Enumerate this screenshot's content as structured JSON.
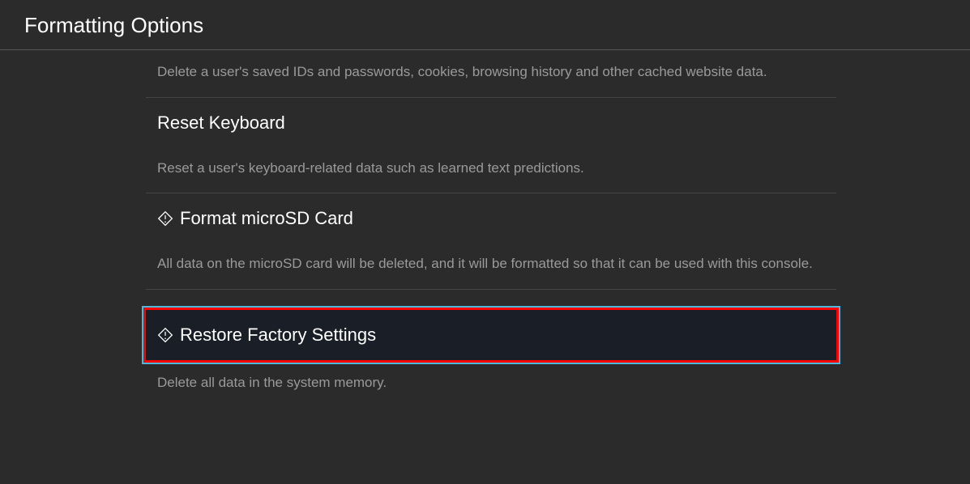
{
  "header": {
    "title": "Formatting Options"
  },
  "options": {
    "item0_description": "Delete a user's saved IDs and passwords, cookies, browsing history and other cached website data.",
    "item1_title": "Reset Keyboard",
    "item1_description": "Reset a user's keyboard-related data such as learned text predictions.",
    "item2_title": "Format microSD Card",
    "item2_description": "All data on the microSD card will be deleted, and it will be formatted so that it can be used with this console.",
    "item3_title": "Restore Factory Settings",
    "item3_description": "Delete all data in the system memory."
  }
}
